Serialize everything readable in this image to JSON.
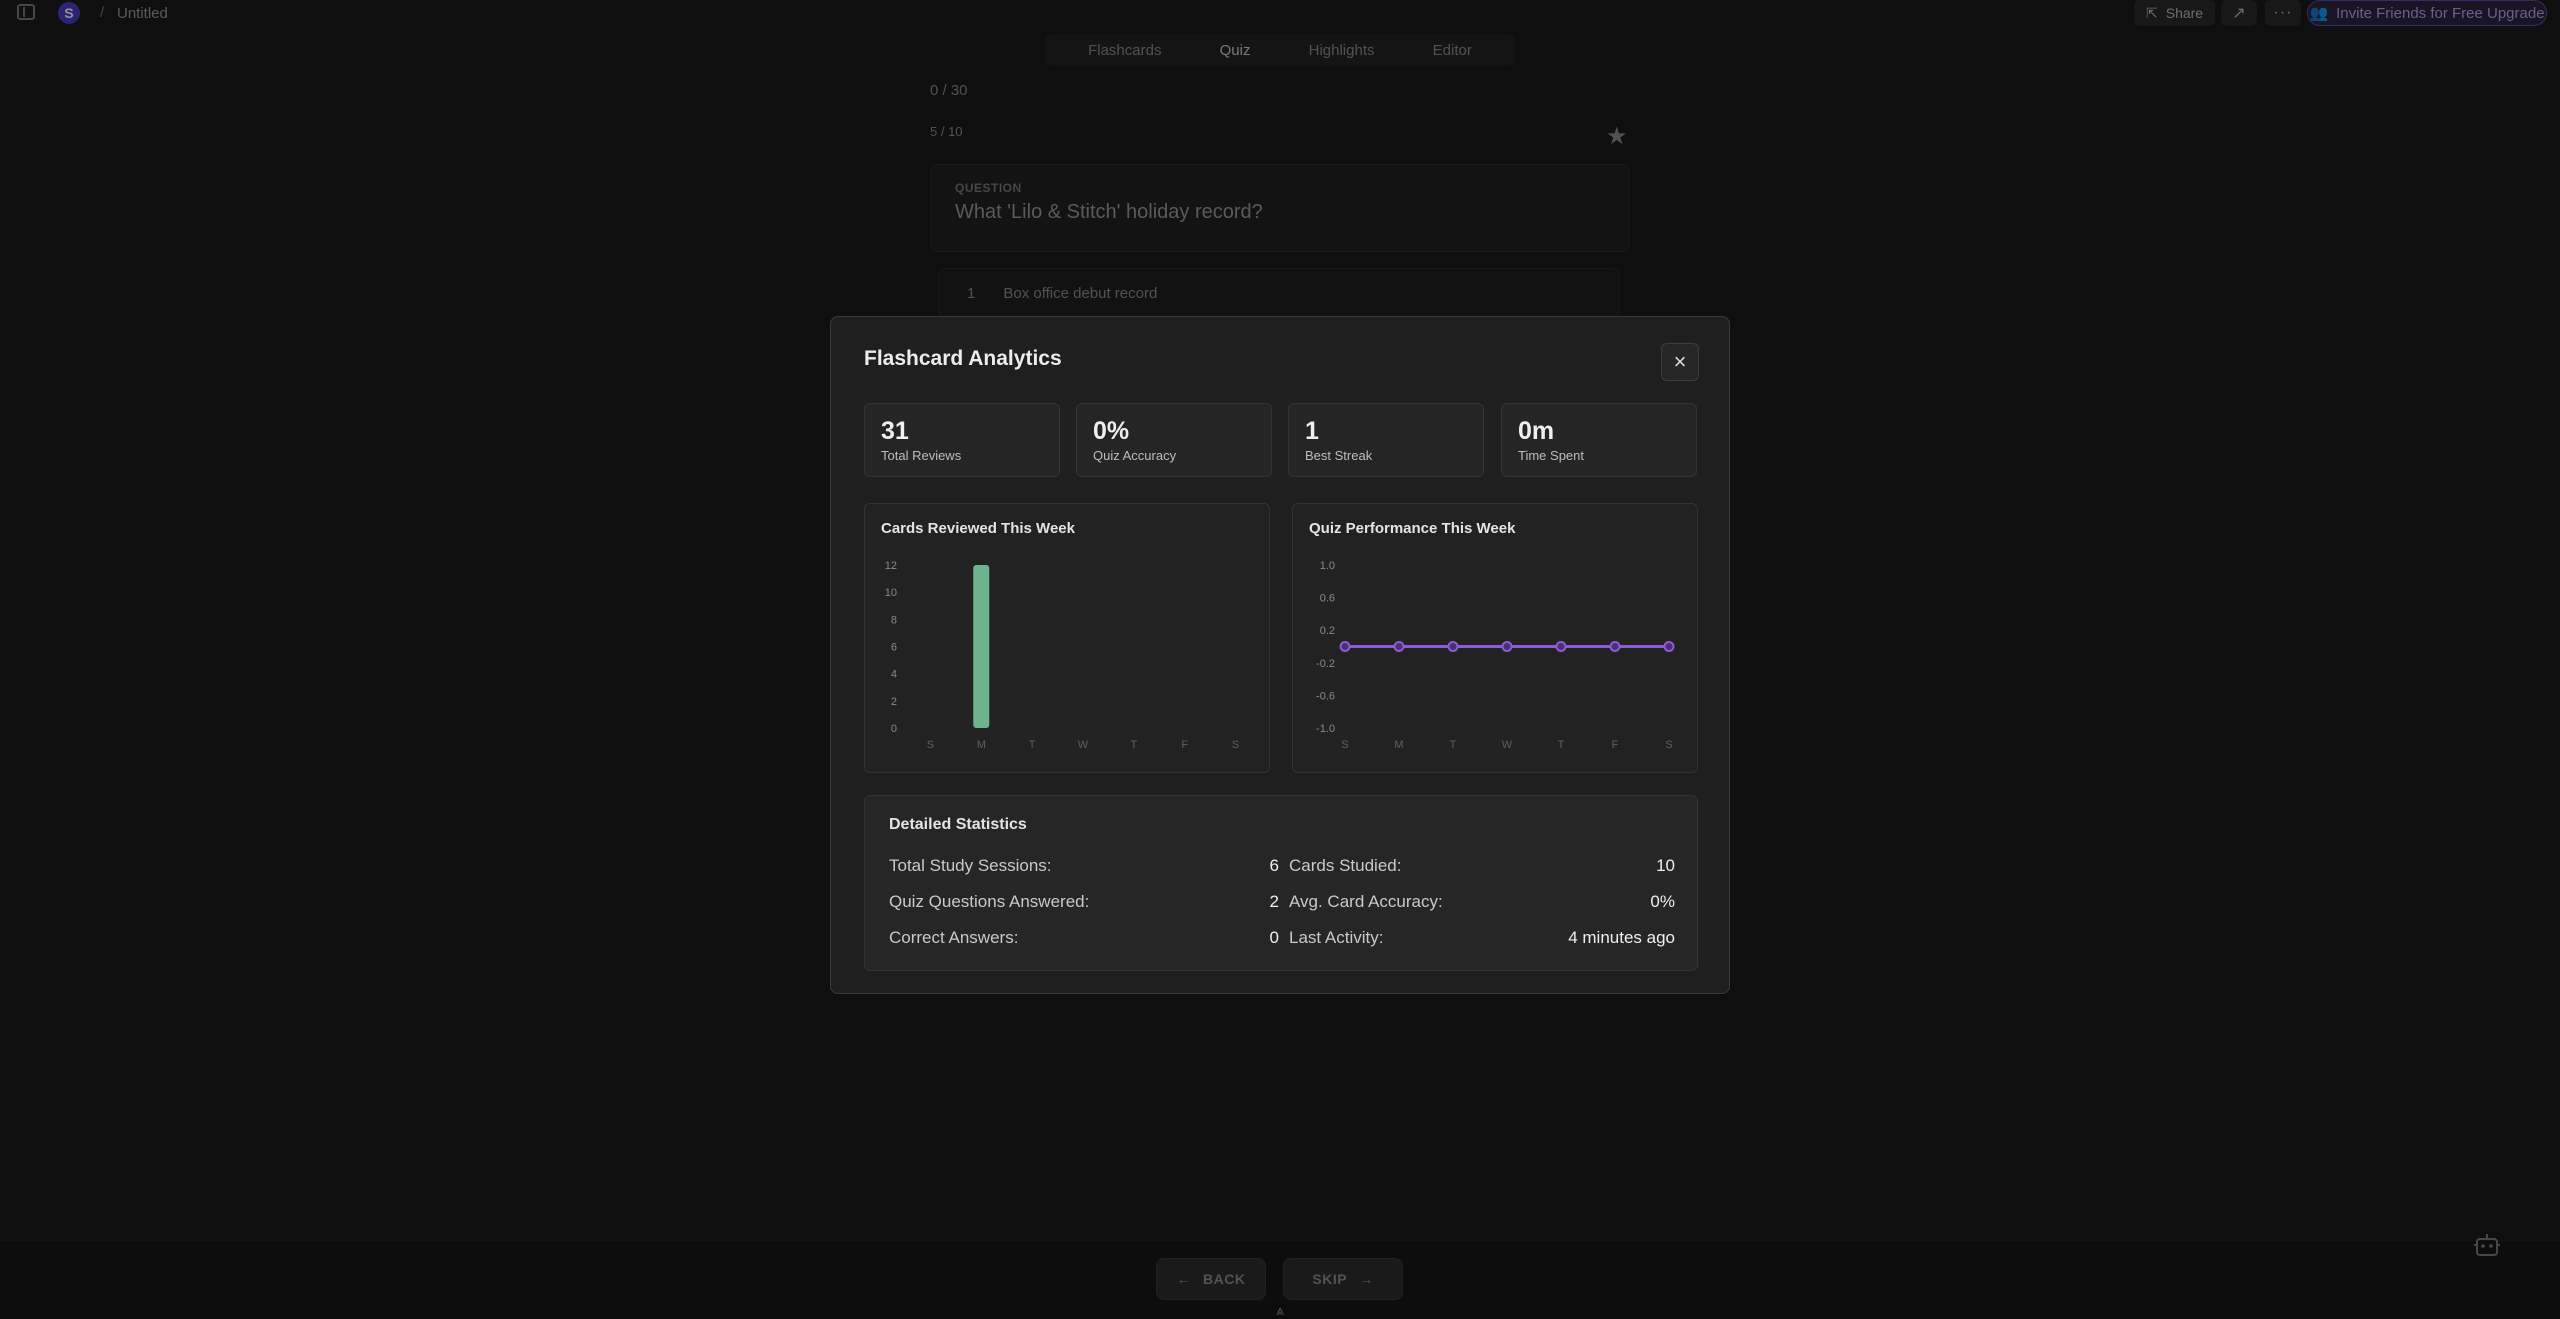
{
  "header": {
    "workspace_initial": "S",
    "separator": "/",
    "doc_title": "Untitled",
    "share_label": "Share",
    "invite_label": "Invite Friends for Free Upgrade"
  },
  "tabs": [
    {
      "label": "Flashcards"
    },
    {
      "label": "Quiz"
    },
    {
      "label": "Highlights"
    },
    {
      "label": "Editor"
    }
  ],
  "quiz": {
    "progress": "0 / 30",
    "card_progress": "5 / 10",
    "question_label": "QUESTION",
    "question_text": "What 'Lilo & Stitch' holiday record?",
    "option_number": "1",
    "option_text": "Box office debut record"
  },
  "footer": {
    "back_label": "BACK",
    "skip_label": "SKIP"
  },
  "modal": {
    "title": "Flashcard Analytics",
    "stats": [
      {
        "value": "31",
        "label": "Total Reviews"
      },
      {
        "value": "0%",
        "label": "Quiz Accuracy"
      },
      {
        "value": "1",
        "label": "Best Streak"
      },
      {
        "value": "0m",
        "label": "Time Spent"
      }
    ],
    "details_title": "Detailed Statistics",
    "details_left": [
      {
        "label": "Total Study Sessions:",
        "value": "6"
      },
      {
        "label": "Quiz Questions Answered:",
        "value": "2"
      },
      {
        "label": "Correct Answers:",
        "value": "0"
      }
    ],
    "details_right": [
      {
        "label": "Cards Studied:",
        "value": "10"
      },
      {
        "label": "Avg. Card Accuracy:",
        "value": "0%"
      },
      {
        "label": "Last Activity:",
        "value": "4 minutes ago"
      }
    ]
  },
  "chart_data": [
    {
      "type": "bar",
      "title": "Cards Reviewed This Week",
      "categories": [
        "S",
        "M",
        "T",
        "W",
        "T",
        "F",
        "S"
      ],
      "values": [
        0,
        12,
        0,
        0,
        0,
        0,
        0
      ],
      "ylim": [
        0,
        12
      ],
      "yticks": [
        "0",
        "2",
        "4",
        "6",
        "8",
        "10",
        "12"
      ],
      "color": "#6fb38e"
    },
    {
      "type": "line",
      "title": "Quiz Performance This Week",
      "categories": [
        "S",
        "M",
        "T",
        "W",
        "T",
        "F",
        "S"
      ],
      "values": [
        0,
        0,
        0,
        0,
        0,
        0,
        0
      ],
      "ylim": [
        -1.0,
        1.0
      ],
      "yticks": [
        "1.0",
        "0.6",
        "0.2",
        "-0.2",
        "-0.6",
        "-1.0"
      ],
      "color": "#8e5bd6"
    }
  ]
}
